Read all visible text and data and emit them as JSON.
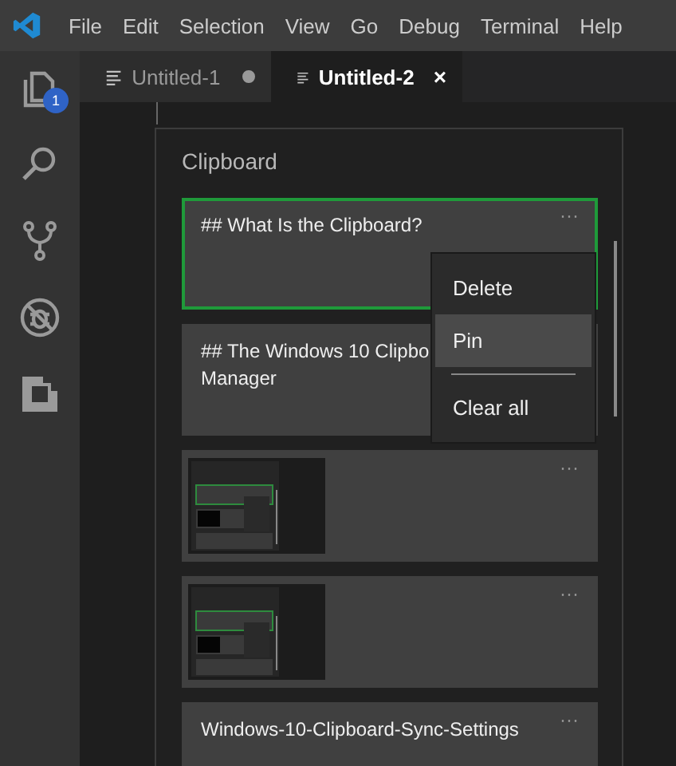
{
  "menu_bar": [
    "File",
    "Edit",
    "Selection",
    "View",
    "Go",
    "Debug",
    "Terminal",
    "Help"
  ],
  "activity_bar": [
    {
      "kind": "files",
      "badge": "1"
    },
    {
      "kind": "search"
    },
    {
      "kind": "branch"
    },
    {
      "kind": "bug"
    },
    {
      "kind": "extensions"
    }
  ],
  "tabs": [
    {
      "label": "Untitled-1",
      "selected": false,
      "modified": true
    },
    {
      "label": "Untitled-2",
      "selected": true,
      "close": "×"
    }
  ],
  "clipboard": {
    "title": "Clipboard",
    "items": [
      {
        "kind": "text",
        "selected": true,
        "lines": [
          "## What Is the Clipboard?"
        ],
        "more": "···"
      },
      {
        "kind": "text",
        "selected": false,
        "lines": [
          "## The Windows 10 Clipbo",
          "Manager"
        ]
      },
      {
        "kind": "image",
        "selected": false,
        "more": "···"
      },
      {
        "kind": "image",
        "selected": false,
        "more": "···"
      },
      {
        "kind": "text",
        "selected": false,
        "lines": [
          "Windows-10-Clipboard-Sync-Settings"
        ],
        "more": "···"
      }
    ],
    "context_menu": [
      {
        "kind": "item",
        "label": "Delete",
        "highlighted": false
      },
      {
        "kind": "item",
        "label": "Pin",
        "highlighted": true
      },
      {
        "kind": "separator"
      },
      {
        "kind": "item",
        "label": "Clear all",
        "highlighted": false
      }
    ]
  }
}
